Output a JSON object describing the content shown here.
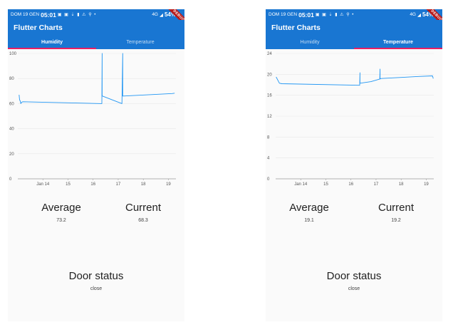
{
  "status_bar": {
    "carrier": "DOM 19 GEN",
    "time": "05:01",
    "icons": "▣ ▣ ⇣ ▮ ⚠ ⚲ •",
    "network": "4G",
    "battery": "54%",
    "debug": "DEBUG"
  },
  "app": {
    "title": "Flutter Charts"
  },
  "tabs": [
    {
      "label": "Humidity"
    },
    {
      "label": "Temperature"
    }
  ],
  "screens": [
    {
      "active_tab": 0,
      "average": {
        "label": "Average",
        "value": "73.2"
      },
      "current": {
        "label": "Current",
        "value": "68.3"
      },
      "door": {
        "label": "Door status",
        "value": "close"
      }
    },
    {
      "active_tab": 1,
      "average": {
        "label": "Average",
        "value": "19.1"
      },
      "current": {
        "label": "Current",
        "value": "19.2"
      },
      "door": {
        "label": "Door status",
        "value": "close"
      }
    }
  ],
  "chart_data": [
    {
      "type": "line",
      "title": "",
      "series": [
        {
          "x": [
            13.05,
            13.07,
            13.1,
            13.12,
            13.15,
            13.2,
            16.35,
            16.36,
            16.36,
            16.37,
            17.15,
            17.18,
            17.18,
            17.2,
            19.15,
            19.25
          ],
          "y": [
            67,
            63,
            62,
            60,
            61,
            61.5,
            60,
            100,
            66,
            66,
            60,
            100,
            66,
            66,
            68,
            68.3
          ]
        }
      ],
      "x_ticks": [
        14,
        15,
        16,
        17,
        18,
        19
      ],
      "x_tick_labels": [
        "Jan 14",
        "15",
        "16",
        "17",
        "18",
        "19"
      ],
      "xlim": [
        13,
        19.3
      ],
      "ylim": [
        0,
        100
      ],
      "y_ticks": [
        0,
        20,
        40,
        60,
        80,
        100
      ],
      "grid": true
    },
    {
      "type": "line",
      "title": "",
      "series": [
        {
          "x": [
            13.02,
            13.15,
            13.25,
            16.35,
            16.36,
            16.36,
            16.37,
            16.8,
            17.15,
            17.16,
            17.16,
            17.2,
            18.0,
            18.7,
            19.25,
            19.28
          ],
          "y": [
            19.5,
            18.3,
            18.2,
            17.9,
            20.3,
            18.3,
            18.3,
            18.6,
            19.1,
            21.0,
            19.1,
            19.2,
            19.4,
            19.6,
            19.7,
            19.2
          ]
        }
      ],
      "x_ticks": [
        14,
        15,
        16,
        17,
        18,
        19
      ],
      "x_tick_labels": [
        "Jan 14",
        "15",
        "16",
        "17",
        "18",
        "19"
      ],
      "xlim": [
        13,
        19.3
      ],
      "ylim": [
        0,
        24
      ],
      "y_ticks": [
        0,
        4,
        8,
        12,
        16,
        20,
        24
      ],
      "grid": true
    }
  ],
  "colors": {
    "app_bar": "#1976d2",
    "indicator": "#e91e63",
    "line": "#2196f3",
    "grid": "#e8e8e8"
  }
}
